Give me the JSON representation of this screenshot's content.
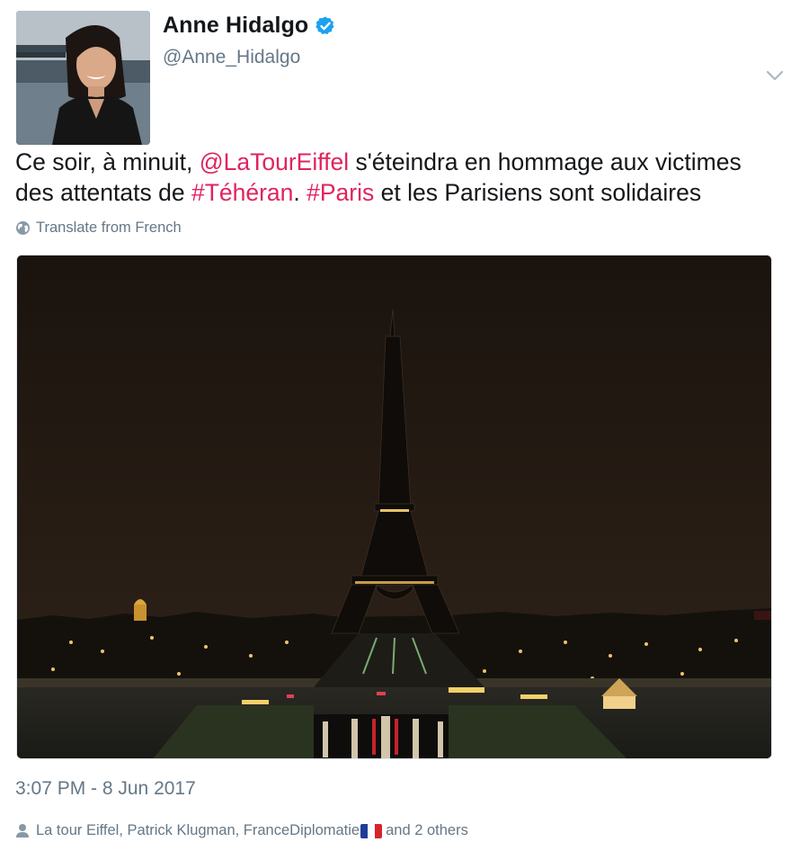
{
  "author": {
    "display_name": "Anne Hidalgo",
    "handle": "@Anne_Hidalgo",
    "verified": true
  },
  "tweet": {
    "text_segments": [
      {
        "text": "Ce soir, à minuit, ",
        "type": "plain"
      },
      {
        "text": "@LaTourEiffel",
        "type": "mention"
      },
      {
        "text": " s'éteindra en hommage aux victimes des attentats de ",
        "type": "plain"
      },
      {
        "text": "#Téhéran",
        "type": "hashtag"
      },
      {
        "text": ". ",
        "type": "plain"
      },
      {
        "text": "#Paris",
        "type": "hashtag"
      },
      {
        "text": " et les Parisiens sont solidaires",
        "type": "plain"
      }
    ],
    "translate_label": "Translate from French",
    "timestamp": "3:07 PM - 8 Jun 2017"
  },
  "tagged": {
    "names": "La tour Eiffel, Patrick Klugman, FranceDiplomatie",
    "others": " and 2 others"
  },
  "icons": {
    "verified": "verified-badge-icon",
    "caret": "chevron-down-icon",
    "translate": "globe-icon",
    "tagged": "person-icon",
    "flag": "france-flag-icon"
  },
  "colors": {
    "link": "#e0245e",
    "secondary_text": "#657786",
    "verified_blue": "#1da1f2"
  }
}
